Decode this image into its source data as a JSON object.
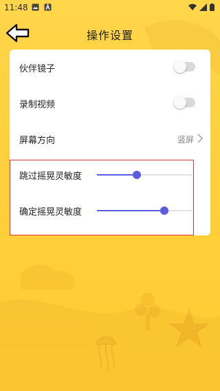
{
  "status_bar": {
    "time": "11:48",
    "icons_left": [
      "image-icon",
      "a-letter-icon"
    ],
    "icons_right": [
      "wifi-icon",
      "signal-icon",
      "battery-icon"
    ]
  },
  "nav": {
    "title": "操作设置",
    "back_icon": "back-arrow-icon"
  },
  "settings": {
    "rows": [
      {
        "label": "伙伴镜子",
        "type": "toggle",
        "on": false
      },
      {
        "label": "录制视频",
        "type": "toggle",
        "on": false
      },
      {
        "label": "屏幕方向",
        "type": "select",
        "value": "竖屏"
      },
      {
        "label": "跳过摇晃灵敏度",
        "type": "slider",
        "value": 0.42
      },
      {
        "label": "确定摇晃灵敏度",
        "type": "slider",
        "value": 0.71
      }
    ]
  },
  "colors": {
    "background": "#ffd03c",
    "accent": "#5b5be0",
    "highlight_border": "#e0323a"
  }
}
